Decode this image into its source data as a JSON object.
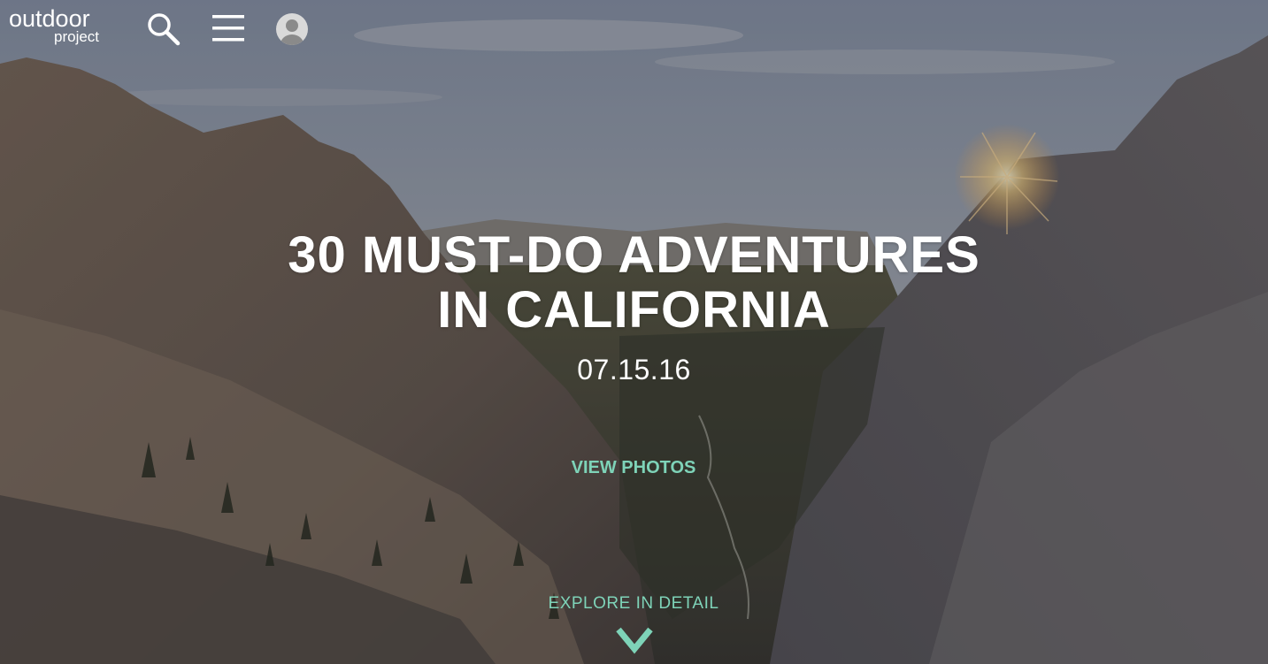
{
  "brand": {
    "logo_line1": "outdoor",
    "logo_line2": "project"
  },
  "nav": {
    "search_icon": "search-icon",
    "menu_icon": "hamburger-menu-icon",
    "account_icon": "user-avatar-icon"
  },
  "hero": {
    "title_line1": "30 MUST-DO ADVENTURES",
    "title_line2": "IN CALIFORNIA",
    "date": "07.15.16",
    "view_photos_label": "VIEW PHOTOS",
    "explore_label": "EXPLORE IN DETAIL",
    "explore_icon": "chevron-down-icon"
  },
  "colors": {
    "accent": "#7ed3b8",
    "text": "#ffffff"
  }
}
